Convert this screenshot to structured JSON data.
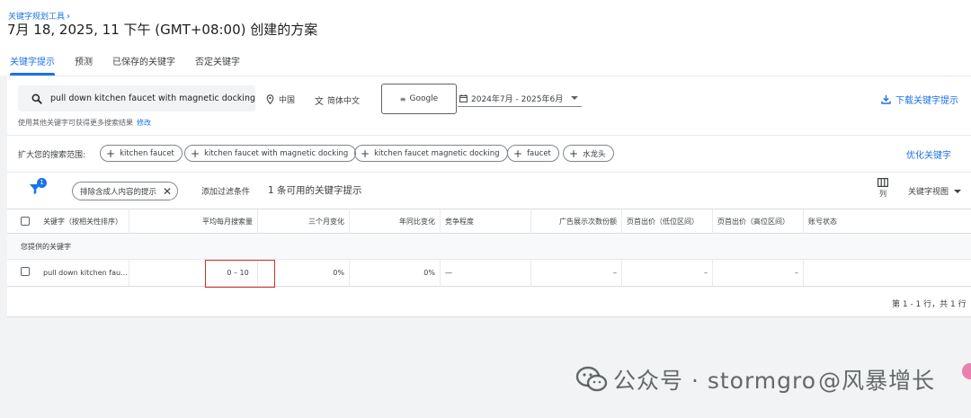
{
  "header": {
    "breadcrumb": "关键字规划工具",
    "plan_title": "7月 18, 2025, 11 下午 (GMT+08:00) 创建的方案",
    "tabs": [
      {
        "label": "关键字提示",
        "active": true
      },
      {
        "label": "预测",
        "active": false
      },
      {
        "label": "已保存的关键字",
        "active": false
      },
      {
        "label": "否定关键字",
        "active": false
      }
    ]
  },
  "search": {
    "query": "pull down kitchen faucet with magnetic docking",
    "location": "中国",
    "language": "简体中文",
    "engine": "Google",
    "date_range": "2024年7月 - 2025年6月",
    "download_label": "下载关键字提示",
    "hint_text": "使用其他关键字可获得更多搜索结果",
    "hint_link": "修改"
  },
  "broaden": {
    "label": "扩大您的搜索范围:",
    "chips": [
      "kitchen faucet",
      "kitchen faucet with magnetic docking",
      "kitchen faucet magnetic docking",
      "faucet",
      "水龙头"
    ],
    "refine_label": "优化关键字"
  },
  "filters": {
    "badge_count": "1",
    "active_filter": "排除含成人内容的提示",
    "add_filter": "添加过滤条件",
    "result_count": "1 条可用的关键字提示",
    "columns_label": "列",
    "view_label": "关键字视图"
  },
  "table": {
    "headers": {
      "keyword": "关键字（按相关性排序）",
      "avg_monthly": "平均每月搜索量",
      "three_month": "三个月变化",
      "yoy": "年同比变化",
      "competition": "竞争程度",
      "impression_share": "广告展示次数份额",
      "bid_low": "页首出价（低位区间）",
      "bid_high": "页首出价（高位区间）",
      "account_status": "账号状态"
    },
    "section_label": "您提供的关键字",
    "row": {
      "keyword": "pull down kitchen fau...",
      "avg_monthly": "0 – 10",
      "three_month": "0%",
      "yoy": "0%",
      "competition": "—",
      "impression_share": "–",
      "bid_low": "–",
      "bid_high": "–",
      "account_status": ""
    },
    "pagination": "第 1 - 1 行，共 1 行"
  },
  "watermark": {
    "text": "公众号 · stormgro",
    "handle": "@风暴增长"
  },
  "colors": {
    "accent": "#1a73e8",
    "highlight_box": "#d93025"
  }
}
